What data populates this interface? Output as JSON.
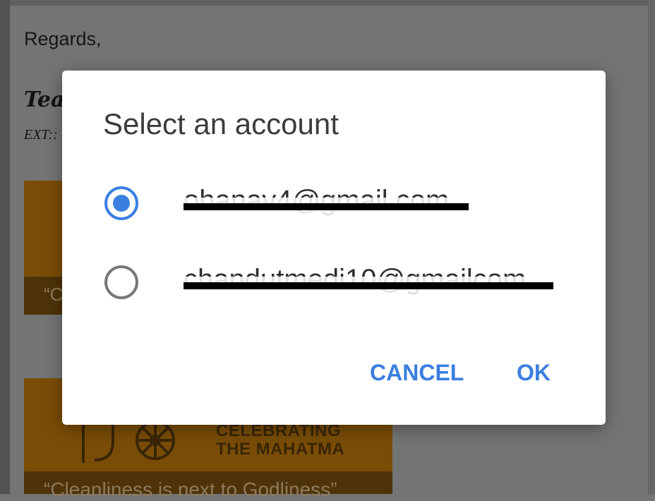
{
  "background_email": {
    "closing": "Regards,",
    "signature_name": "Tea",
    "signature_ext": "EXT::",
    "banner_1_quote": "“C",
    "banner_2_title_line1": "CELEBRATING",
    "banner_2_title_line2": "THE MAHATMA",
    "banner_2_quote": "“Cleanliness is next to Godliness”"
  },
  "dialog": {
    "title": "Select an account",
    "accounts": [
      {
        "email": "ohanav4@gmail.com",
        "selected": true
      },
      {
        "email": "chandutmedi10@gmailcom",
        "selected": false
      }
    ],
    "cancel_label": "CANCEL",
    "ok_label": "OK"
  },
  "colors": {
    "accent": "#3a7fe0",
    "scrim": "#747474",
    "banner": "#7a4d07"
  }
}
